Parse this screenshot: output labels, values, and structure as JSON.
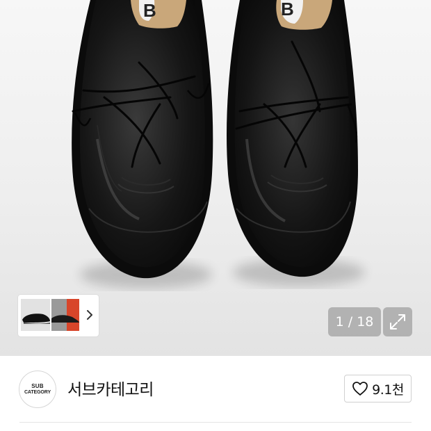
{
  "gallery": {
    "counter_text": "1 / 18",
    "current": 1,
    "total": 18,
    "thumbnails": [
      "black-shoe-side-view",
      "red-shoe-view"
    ],
    "next_icon": "chevron-right-icon",
    "fullscreen_icon": "expand-icon"
  },
  "store": {
    "logo_line1": "SUB",
    "logo_line2": "CATEGORY",
    "name": "서브카테고리",
    "like_icon": "heart-icon",
    "like_count": "9.1천"
  },
  "colors": {
    "text": "#111111",
    "border": "#d0d0d0",
    "overlay": "#a0a0a0"
  }
}
